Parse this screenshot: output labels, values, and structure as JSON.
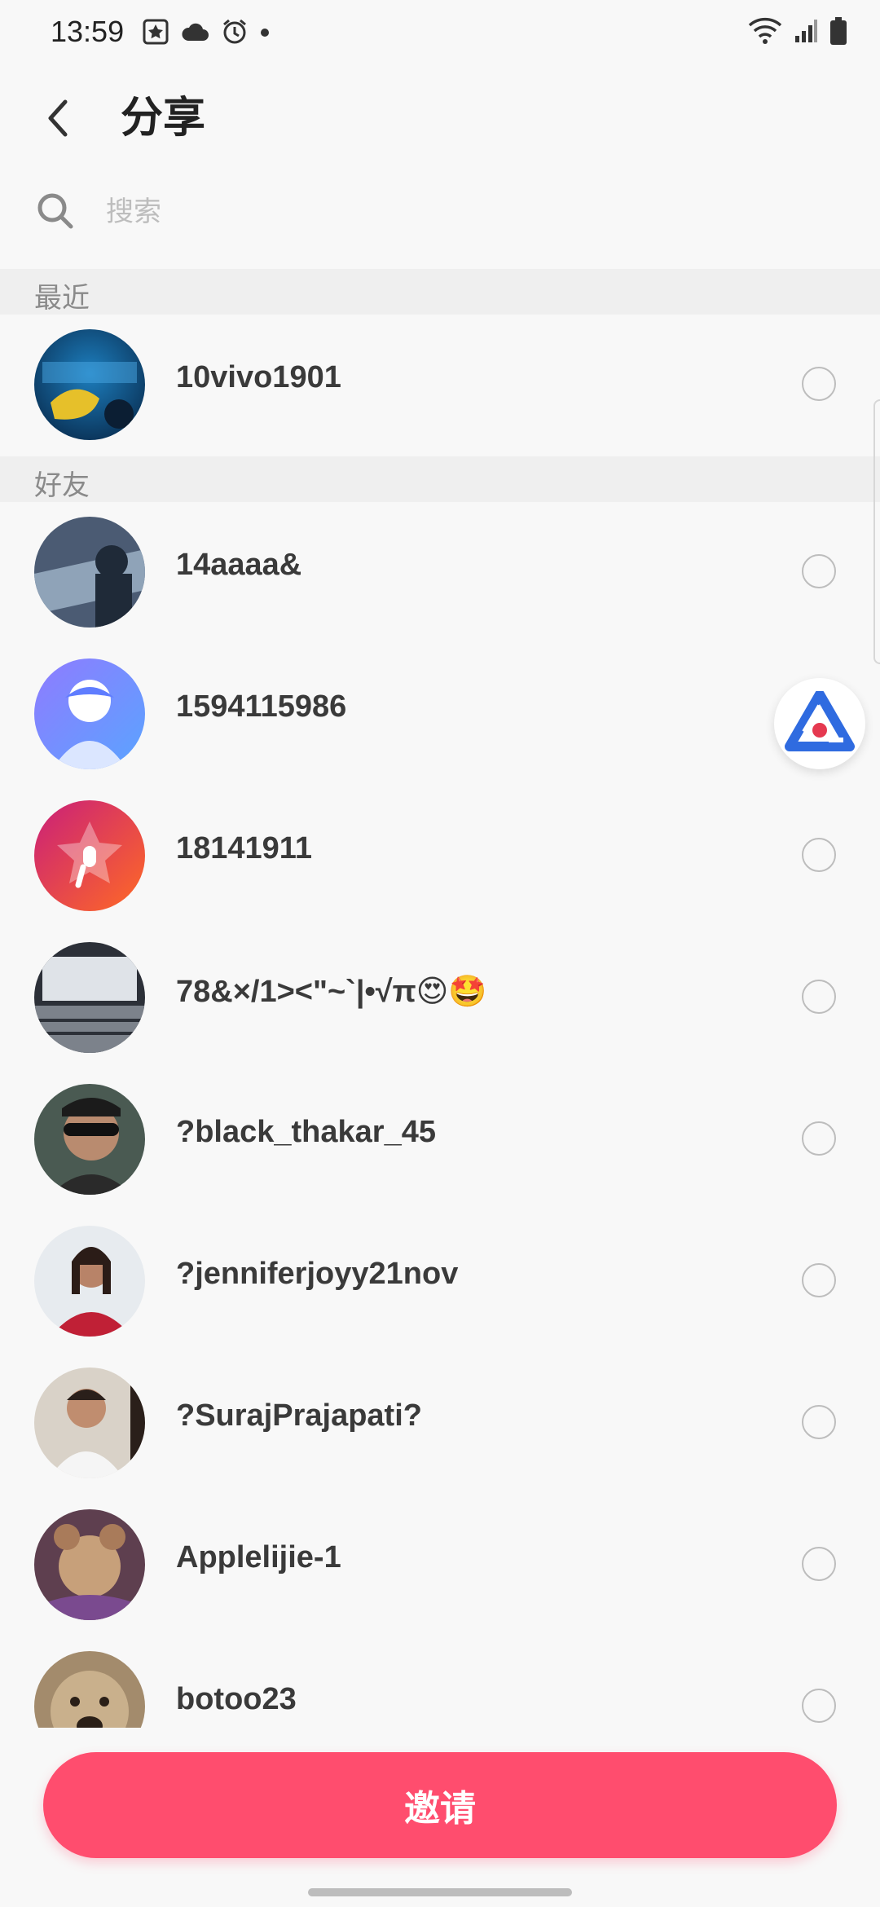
{
  "status_bar": {
    "time": "13:59"
  },
  "header": {
    "title": "分享"
  },
  "search": {
    "placeholder": "搜索"
  },
  "sections": {
    "recent": "最近",
    "friends": "好友"
  },
  "recent": [
    {
      "name": "10vivo1901"
    }
  ],
  "friends": [
    {
      "name": "14aaaa&"
    },
    {
      "name": "1594115986"
    },
    {
      "name": "18141911"
    },
    {
      "name": "78&×/1><\"~`|•√π😍🤩"
    },
    {
      "name": "?black_thakar_45"
    },
    {
      "name": "?jenniferjoyy21nov"
    },
    {
      "name": "?SurajPrajapati?"
    },
    {
      "name": "Applelijie-1"
    },
    {
      "name": "botoo23"
    }
  ],
  "footer": {
    "invite_label": "邀请"
  },
  "colors": {
    "accent": "#FF4D6E",
    "floating_logo_blue": "#2F6BE0",
    "floating_logo_red": "#E53950"
  }
}
